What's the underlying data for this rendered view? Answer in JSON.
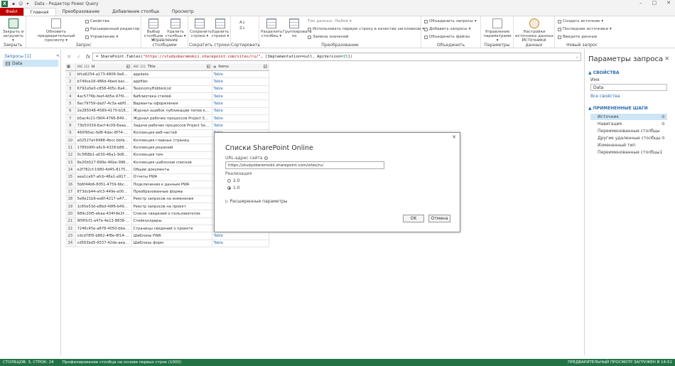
{
  "window": {
    "app_icon": "X",
    "title": "Data - Редактор Power Query",
    "controls": [
      "–",
      "□",
      "✕"
    ]
  },
  "tabs": [
    "Файл",
    "Главная",
    "Преобразование",
    "Добавление столбца",
    "Просмотр"
  ],
  "ribbon": {
    "close_load": "Закрыть и загрузить",
    "refresh_preview": "Обновить предварительный просмотр",
    "properties": "Свойства",
    "advanced_editor": "Расширенный редактор",
    "manage": "Управление",
    "choose_columns": "Выбор столбцов",
    "remove_columns": "Удалить столбцы",
    "keep_rows": "Сохранить строки",
    "remove_rows": "Удалить строки",
    "split_column": "Разделить столбец",
    "group_by": "Группировать по",
    "data_type": "Тип данных: Любой",
    "use_first_row": "Использовать первую строку в качестве заголовков",
    "replace_values": "Замена значений",
    "merge_queries": "Объединить запросы",
    "append_queries": "Добавить запросы",
    "combine_files": "Объединить файлы",
    "manage_params": "Управление параметрами",
    "ds_settings": "Настройки источника данных",
    "new_source": "Создать источник",
    "recent_sources": "Последние источники",
    "enter_data": "Введите данные",
    "groups": [
      "Закрыть",
      "Запрос",
      "Управление столбцами",
      "Сократить строки",
      "Сортировать",
      "Преобразование",
      "Объединить",
      "Параметры",
      "Источники данных",
      "Новый запрос"
    ]
  },
  "queries": {
    "header": "Запросы [1]",
    "collapse": "<",
    "items": [
      "Data"
    ]
  },
  "formula": {
    "cancel": "✕",
    "commit": "✓",
    "fx": "fx",
    "prefix": "= SharePoint.Tables(",
    "url": "\"https://studyoberemokii.sharepoint.com/sites/ru/\"",
    "mid": ", [Implementation=null, ApiVersion=",
    "ver": "15",
    "suffix": "])"
  },
  "grid": {
    "columns": [
      "Id",
      "Title",
      "Items"
    ],
    "type_label": "ABC 123",
    "rows": [
      [
        "bfca6254-a173-4806-9a62-4b...",
        "appdata",
        "Table"
      ],
      [
        "b749ce18-486d-4bed-bacc-8...",
        "appfiles",
        "Table"
      ],
      [
        "6792a5e0-c858-405c-8a40-a...",
        "TaxonomyHiddenList",
        "Table"
      ],
      [
        "4ac5776b-feef-4d5e-97f0-cd...",
        "Библиотека стилей",
        "Table"
      ],
      [
        "8ac79759-dad7-4c3a-abf0-31...",
        "Варианты оформления",
        "Table"
      ],
      [
        "2e285048-4589-4170-b168-2...",
        "Журнал ошибок публикации типов конте...",
        "Table"
      ],
      [
        "b5ac4c21-f904-4766-8497-dc...",
        "Журнал рабочих процессов Project Server",
        "Table"
      ],
      [
        "73b50339-6acf-4c09-8aaa-eb...",
        "Задачи рабочих процессов Project Server",
        "Table"
      ],
      [
        "460f90ac-fe8f-4dac-8f74-ad0...",
        "Коллекция веб-частей",
        "Table"
      ],
      [
        "a02527af-8488-4bcc-bbfa-19...",
        "Коллекция главных страниц",
        "Table"
      ],
      [
        "1785b9f0-a6c9-4328-b868-2...",
        "Коллекция решений",
        "Table"
      ],
      [
        "0c3f68b1-a030-46a1-9d64-8...",
        "Коллекция тем",
        "Table"
      ],
      [
        "8e20b527-899e-46be-9968-e...",
        "Коллекция шаблонов списков",
        "Table"
      ],
      [
        "e2f782cf-1980-4d45-8175-e1...",
        "Общие документы",
        "Table"
      ],
      [
        "aea1ca97-afcb-48a1-a917-c4...",
        "Отчеты PWA",
        "Table"
      ],
      [
        "5b6f44b6-8051-4759-9bc8-0...",
        "Подключения к данным PWA",
        "Table"
      ],
      [
        "873dcb44-afc3-449e-a004-3a...",
        "Преобразованные формы",
        "Table"
      ],
      [
        "5e8e21b9-ea6f-4217-a474-0...",
        "Реестр запросов на изменения",
        "Table"
      ],
      [
        "1c65e53d-e8bd-49f6-b499-e...",
        "Реестр запросов на проект",
        "Table"
      ],
      [
        "689c20f5-ebaa-434f-8e2f-52...",
        "Список сведений о пользователях",
        "Table"
      ],
      [
        "9f0f0cf1-a47e-4e13-8838-e5...",
        "Стейкхолдеры",
        "Table"
      ],
      [
        "7246c45e-a878-4050-bbe8-5...",
        "Страницы сведений о проекте",
        "Table"
      ],
      [
        "cdcd78f5-b862-4f8e-8f14-e0...",
        "Шаблоны PWA",
        "Table"
      ],
      [
        "cd563bd5-6537-42de-aeae-6...",
        "Шаблоны форм",
        "Table"
      ]
    ]
  },
  "settings": {
    "title": "Параметры запроса",
    "close": "✕",
    "props_header": "▲ СВОЙСТВА",
    "name_label": "Имя",
    "name_value": "Data",
    "all_props": "Все свойства",
    "steps_header": "▲ ПРИМЕНЕННЫЕ ШАГИ",
    "steps": [
      "Источник",
      "Навигация",
      "Переименованные столбцы",
      "Другие удаленные столбцы",
      "Измененный тип",
      "Переименованные столбцы1"
    ]
  },
  "dialog": {
    "title": "Списки SharePoint Online",
    "close": "✕",
    "url_label": "URL-адрес сайта",
    "url_value": "https://studyoberemokii.sharepoint.com/sites/ru/",
    "impl_label": "Реализация",
    "options": [
      "2.0",
      "1.0"
    ],
    "selected": "1.0",
    "advanced": "▷ Расширенные параметры",
    "ok": "OK",
    "cancel": "Отмена"
  },
  "status": {
    "left": "СТОЛБЦОВ: 3, СТРОК: 24",
    "middle": "Профилирование столбца на основе первых строк (1000)",
    "right": "ПРЕДВАРИТЕЛЬНЫЙ ПРОСМОТР ЗАГРУЖЕН В 14:51"
  },
  "colors": {
    "accent": "#217346",
    "file_tab": "#c00000",
    "link": "#2b6cb0",
    "selection": "#cde6f7"
  }
}
